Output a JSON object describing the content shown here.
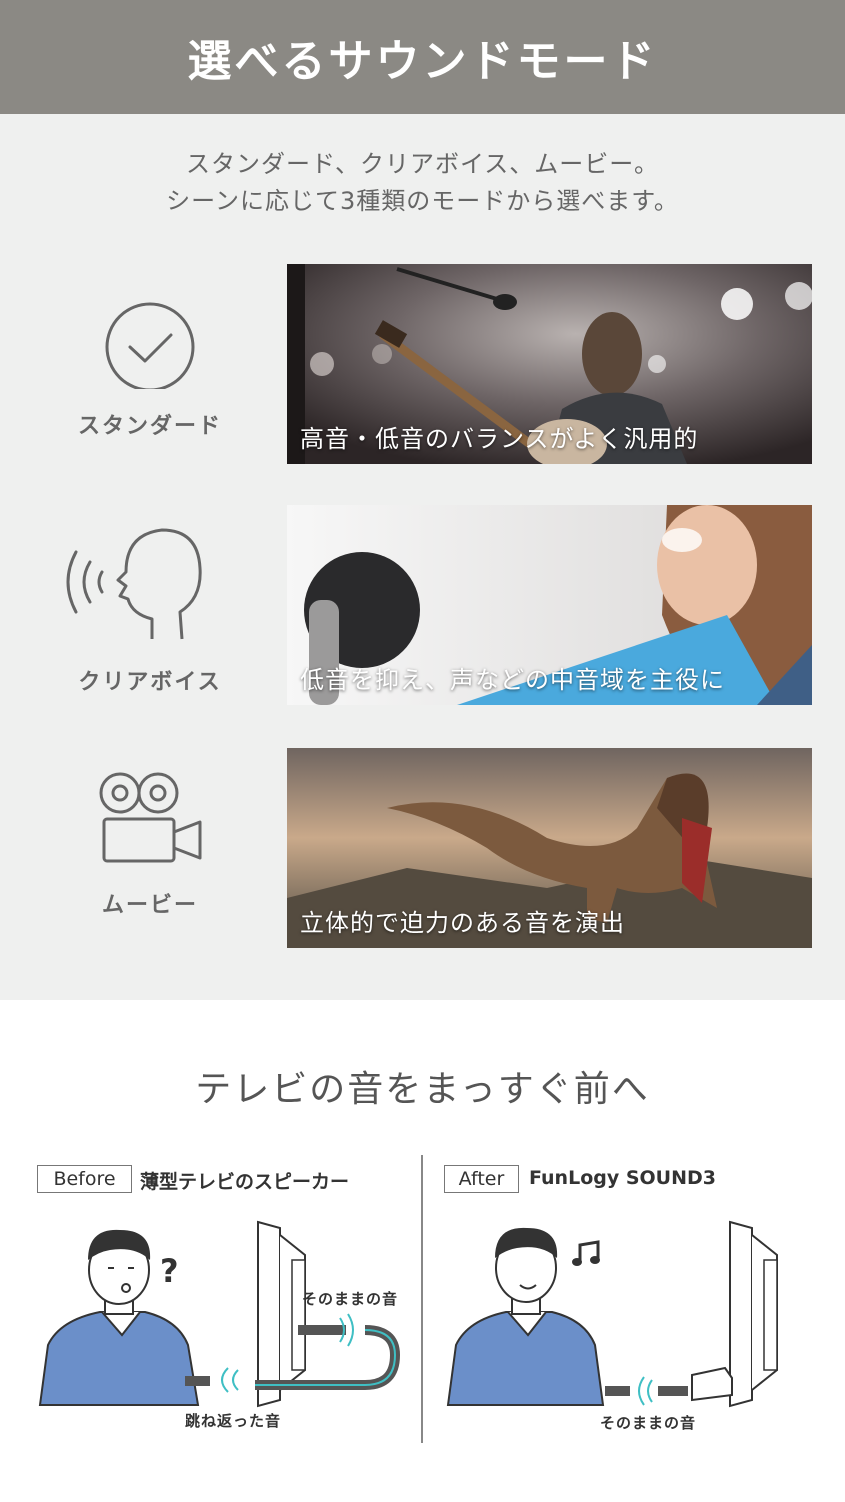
{
  "header": {
    "title": "選べるサウンドモード"
  },
  "intro": {
    "line1": "スタンダード、クリアボイス、ムービー。",
    "line2": "シーンに応じて3種類のモードから選べます。"
  },
  "modes": [
    {
      "label": "スタンダード",
      "icon": "check-circle-icon",
      "caption": "高音・低音のバランスがよく汎用的"
    },
    {
      "label": "クリアボイス",
      "icon": "speaking-head-icon",
      "caption": "低音を抑え、声などの中音域を主役に"
    },
    {
      "label": "ムービー",
      "icon": "movie-camera-icon",
      "caption": "立体的で迫力のある音を演出"
    }
  ],
  "comparison": {
    "title": "テレビの音をまっすぐ前へ",
    "before": {
      "tag": "Before",
      "description": "薄型テレビのスピーカー",
      "sound_label": "そのままの音",
      "reflect_label": "跳ね返った音"
    },
    "after": {
      "tag": "After",
      "description": "FunLogy SOUND3",
      "sound_label": "そのままの音"
    }
  },
  "colors": {
    "header_bg": "#8b8984",
    "section_bg": "#eff0ef",
    "accent_teal": "#3fbfc4",
    "shirt_blue": "#6b8fc9"
  }
}
